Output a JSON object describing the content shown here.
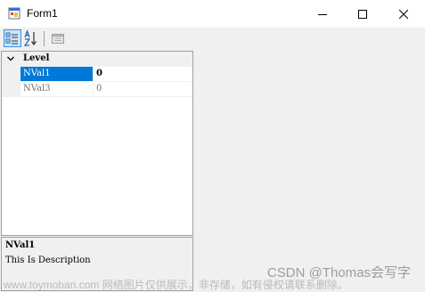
{
  "window": {
    "title": "Form1"
  },
  "caption_buttons": {
    "minimize": "minimize-icon",
    "maximize": "maximize-icon",
    "close": "close-icon"
  },
  "toolbar": {
    "categorized": "categorized-icon",
    "alphabetical": "alphabetical-sort-icon",
    "property_pages": "property-pages-icon"
  },
  "property_grid": {
    "category": "Level",
    "rows": [
      {
        "name": "NVal1",
        "value": "0",
        "selected": true
      },
      {
        "name": "NVal3",
        "value": "0",
        "selected": false
      }
    ]
  },
  "description": {
    "title": "NVal1",
    "text": "This Is Description"
  },
  "watermarks": {
    "csdn": "CSDN @Thomas会写字",
    "site": "www.toymoban.com 网络图片仅供展示，非存储，如有侵权请联系删除。"
  },
  "colors": {
    "selection": "#0078d7",
    "window_bg": "#f0f0f0",
    "titlebar_bg": "#ffffff"
  }
}
